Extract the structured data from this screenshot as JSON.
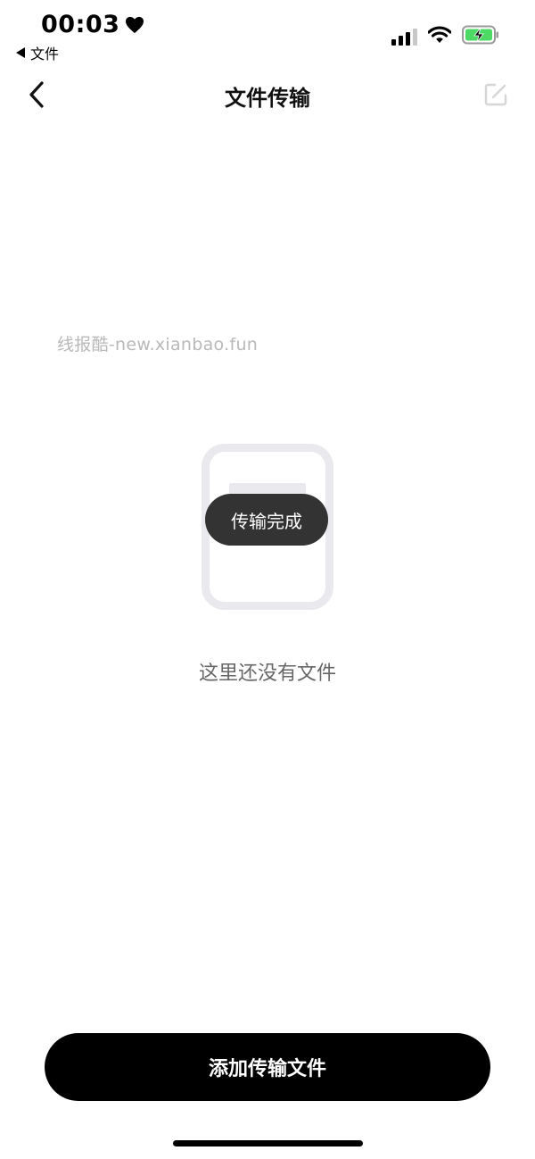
{
  "status_bar": {
    "time": "00:03",
    "back_app_label": "文件"
  },
  "nav": {
    "title": "文件传输"
  },
  "watermark": "线报酷-new.xianbao.fun",
  "toast": "传输完成",
  "empty_state": {
    "message": "这里还没有文件"
  },
  "footer": {
    "add_button_label": "添加传输文件"
  },
  "colors": {
    "battery_green": "#4cd964",
    "toast_bg": "#333333",
    "button_bg": "#000000",
    "illustration": "#e9e9ee"
  },
  "icons": {
    "status": [
      "heart-icon",
      "signal-icon",
      "wifi-icon",
      "battery-charging-icon"
    ],
    "nav": [
      "back-chevron-icon",
      "edit-icon"
    ]
  }
}
